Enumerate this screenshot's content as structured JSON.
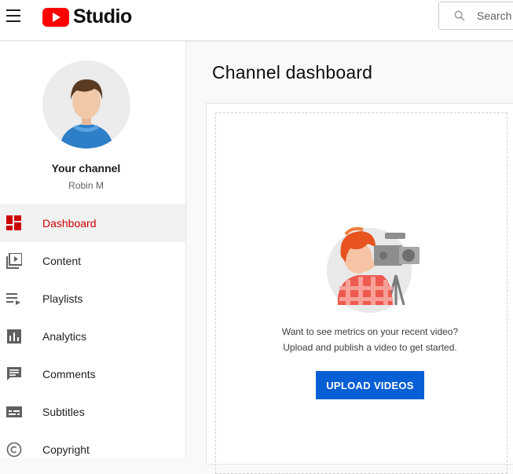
{
  "header": {
    "logo_text": "Studio",
    "search_placeholder": "Search"
  },
  "sidebar": {
    "channel_title": "Your channel",
    "channel_user": "Robin M",
    "items": [
      {
        "label": "Dashboard",
        "icon": "dashboard-icon",
        "active": true
      },
      {
        "label": "Content",
        "icon": "content-icon",
        "active": false
      },
      {
        "label": "Playlists",
        "icon": "playlists-icon",
        "active": false
      },
      {
        "label": "Analytics",
        "icon": "analytics-icon",
        "active": false
      },
      {
        "label": "Comments",
        "icon": "comments-icon",
        "active": false
      },
      {
        "label": "Subtitles",
        "icon": "subtitles-icon",
        "active": false
      },
      {
        "label": "Copyright",
        "icon": "copyright-icon",
        "active": false
      }
    ]
  },
  "main": {
    "title": "Channel dashboard",
    "prompt_line1": "Want to see metrics on your recent video?",
    "prompt_line2": "Upload and publish a video to get started.",
    "upload_button": "UPLOAD VIDEOS"
  },
  "colors": {
    "brand_red": "#ff0000",
    "active_red": "#cc0000",
    "upload_blue": "#065fd4"
  }
}
